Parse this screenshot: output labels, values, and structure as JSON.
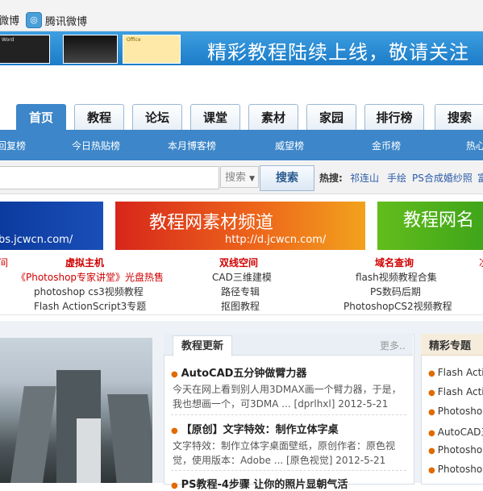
{
  "topbar": {
    "link1": "微博",
    "link2": "腾讯微博",
    "link2_icon": "tencent-weibo-icon"
  },
  "banner": {
    "slogan": "精彩教程陆续上线，敬请关注",
    "thumb1_text": "Word",
    "thumb3_text": "Office"
  },
  "nav": {
    "tabs": [
      "首页",
      "教程",
      "论坛",
      "课堂",
      "素材",
      "家园",
      "排行榜",
      "搜索"
    ],
    "active_tab": "首页",
    "sub": [
      "回复榜",
      "今日热贴榜",
      "本月博客榜",
      "威望榜",
      "金币榜",
      "热心"
    ]
  },
  "search": {
    "value": "",
    "scope": "搜索",
    "button": "搜索",
    "hot_label": "热搜:",
    "hot": [
      "祁连山",
      "手绘",
      "PS合成婚纱照",
      "富"
    ]
  },
  "ads": {
    "ad1_url": "bs.jcwcn.com/",
    "ad2_title": "教程网素材频道",
    "ad2_url": "http://d.jcwcn.com/",
    "ad3_title": "教程网名",
    "accent_red": "#d7261b",
    "accent_blue": "#0c3b9e",
    "accent_green": "#62bd1c"
  },
  "links": {
    "col0": [
      "间"
    ],
    "col1": [
      "虚拟主机",
      "《Photoshop专家讲堂》光盘热售",
      "photoshop cs3视频教程",
      "Flash ActionScript3专题"
    ],
    "col2": [
      "双线空间",
      "CAD三维建模",
      "路径专辑",
      "抠图教程"
    ],
    "col3": [
      "域名查询",
      "flash视频教程合集",
      "PS数码后期",
      "PhotoshopCS2视频教程"
    ],
    "col4": [
      "次"
    ]
  },
  "updates": {
    "tab": "教程更新",
    "more": "更多..",
    "articles": [
      {
        "title": "AutoCAD五分钟做臂力器",
        "desc": "今天在网上看到别人用3DMAX画一个臂力器，于是，我也想画一个，可3DMA ... [dprlhxl] 2012-5-21"
      },
      {
        "title": "【原创】文字特效：制作立体字桌",
        "desc": "文字特效：制作立体字桌面壁纸，原创作者：原色视觉，使用版本：Adobe ... [原色视觉] 2012-5-21"
      },
      {
        "title": "PS教程-4步骤 让你的照片显朝气活",
        "desc": ""
      }
    ]
  },
  "topics": {
    "title": "精彩专题",
    "items": [
      "Flash Action",
      "Flash Action",
      "Photoshop",
      "AutoCAD三",
      "Photoshop",
      "Photoshop"
    ]
  }
}
